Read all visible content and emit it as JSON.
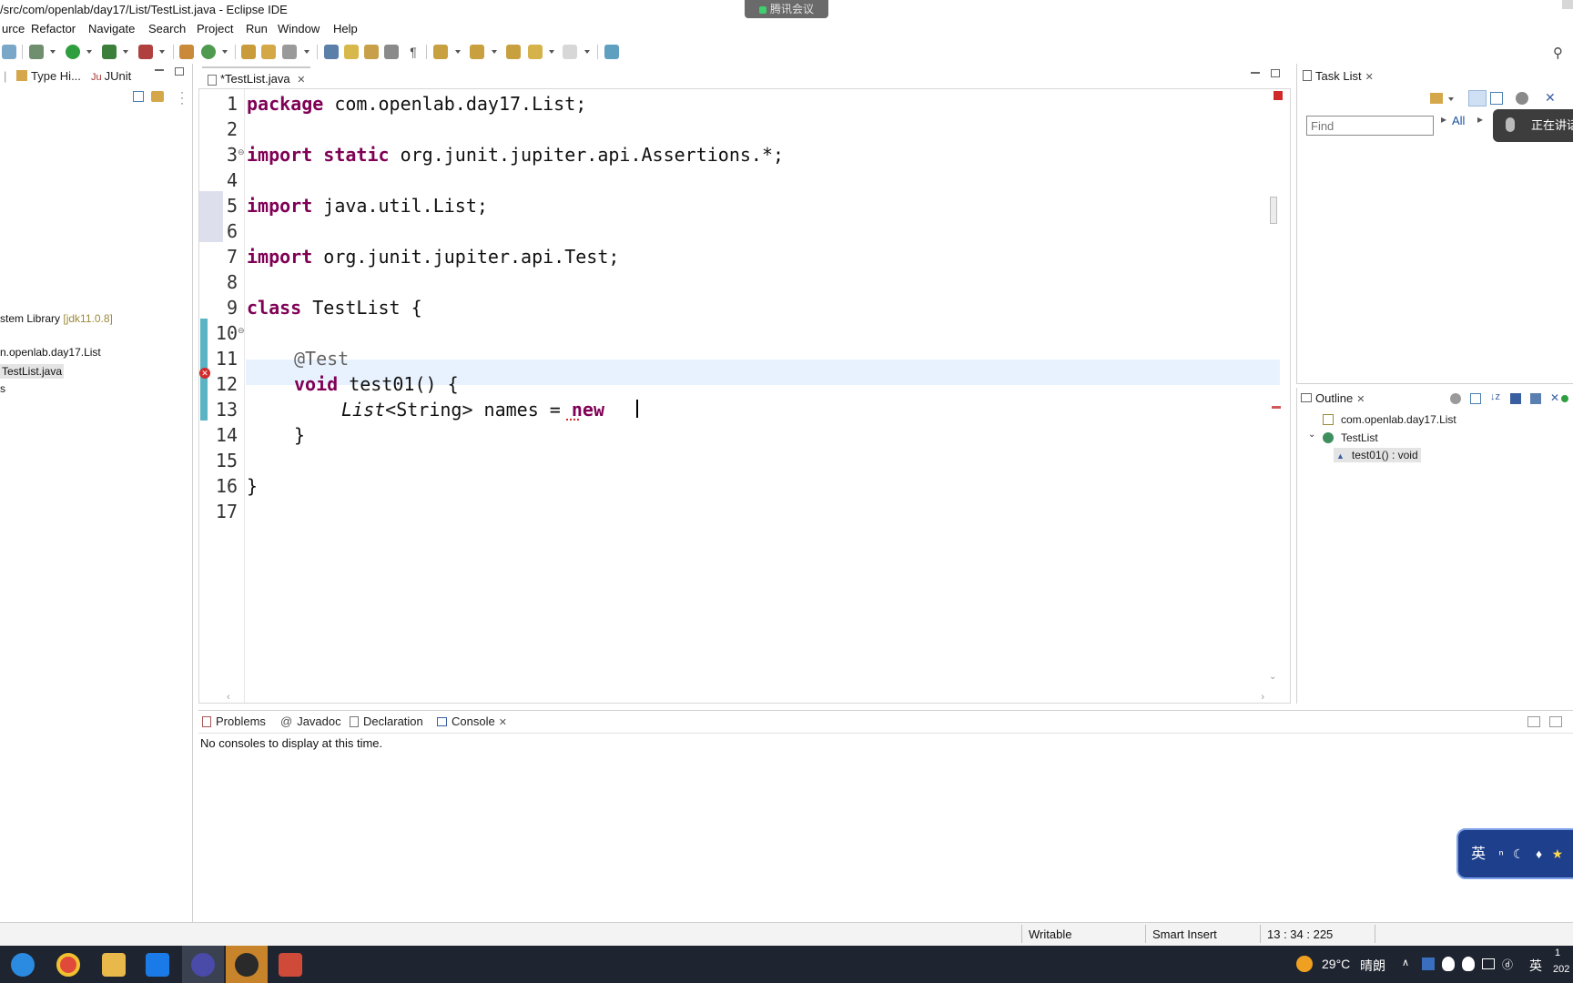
{
  "window": {
    "title": "/src/com/openlab/day17/List/TestList.java - Eclipse IDE",
    "meeting_label": "腾讯会议"
  },
  "menu": [
    "urce",
    "Refactor",
    "Navigate",
    "Search",
    "Project",
    "Run",
    "Window",
    "Help"
  ],
  "left_panel": {
    "tabs": [
      "Type Hi...",
      "JUnit"
    ],
    "tree": [
      {
        "label": "stem Library",
        "suffix": "[jdk11.0.8]"
      },
      {
        "label": "n.openlab.day17.List"
      },
      {
        "label": "TestList.java"
      },
      {
        "label": "s"
      }
    ]
  },
  "editor": {
    "tab_label": "*TestList.java",
    "line_numbers": [
      "1",
      "2",
      "3",
      "4",
      "5",
      "6",
      "7",
      "8",
      "9",
      "10",
      "11",
      "12",
      "13",
      "14",
      "15",
      "16",
      "17"
    ],
    "code": {
      "l1_kw": "package",
      "l1_rest": " com.openlab.day17.List;",
      "l3_kw": "import static",
      "l3_rest": " org.junit.jupiter.api.Assertions.*;",
      "l5_kw": "import",
      "l5_rest": " java.util.List;",
      "l7_kw": "import",
      "l7_rest": " org.junit.jupiter.api.Test;",
      "l9_kw": "class",
      "l9_rest": " TestList {",
      "l11_ann": "@Test",
      "l12_kw": "void",
      "l12_rest": " test01() {",
      "l13_type": "List",
      "l13_mid": "<String> names = ",
      "l13_kw": "new",
      "l14": "}",
      "l16": "}"
    }
  },
  "task_list": {
    "tab_label": "Task List",
    "find_placeholder": "Find",
    "all_label": "All",
    "tooltip": "正在讲话"
  },
  "outline": {
    "tab_label": "Outline",
    "items": [
      {
        "label": "com.openlab.day17.List"
      },
      {
        "label": "TestList"
      },
      {
        "label": "test01() : void"
      }
    ]
  },
  "bottom_panel": {
    "tabs": [
      "Problems",
      "Javadoc",
      "Declaration",
      "Console"
    ],
    "console_message": "No consoles to display at this time."
  },
  "status_bar": {
    "writable": "Writable",
    "insert_mode": "Smart Insert",
    "position": "13 : 34 : 225"
  },
  "ime_widget": {
    "label": "英"
  },
  "taskbar": {
    "weather": "29°C",
    "weather_desc": "晴朗",
    "ime": "英",
    "clock_line1": "1",
    "clock_line2": "202"
  },
  "colors": {
    "keyword": "#7f0055",
    "annotation": "#646464",
    "current_line": "#e8f2fe",
    "change_marker": "#5bb4c4",
    "error": "#d02b2b"
  }
}
